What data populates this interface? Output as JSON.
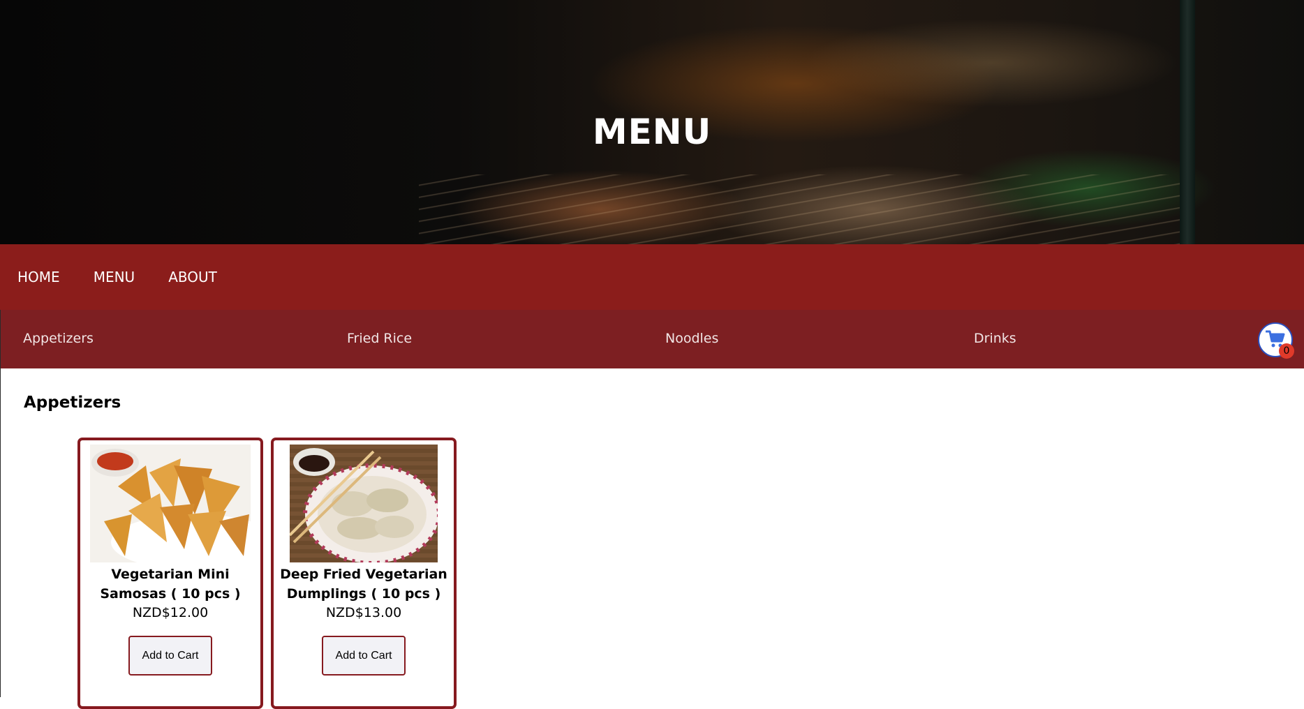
{
  "hero": {
    "title": "MENU"
  },
  "main_nav": {
    "items": [
      {
        "label": "HOME"
      },
      {
        "label": "MENU"
      },
      {
        "label": "ABOUT"
      }
    ]
  },
  "category_nav": {
    "items": [
      {
        "label": "Appetizers"
      },
      {
        "label": "Fried Rice"
      },
      {
        "label": "Noodles"
      },
      {
        "label": "Drinks"
      }
    ],
    "cart": {
      "icon": "shopping-cart-icon",
      "count": "0"
    }
  },
  "section": {
    "title": "Appetizers",
    "products": [
      {
        "name": "Vegetarian Mini Samosas ( 10 pcs )",
        "price": "NZD$12.00",
        "button_label": "Add to Cart",
        "image": "samosas-photo"
      },
      {
        "name": "Deep Fried Vegetarian Dumplings ( 10 pcs )",
        "price": "NZD$13.00",
        "button_label": "Add to Cart",
        "image": "dumplings-photo"
      }
    ]
  },
  "colors": {
    "nav_primary": "#8b1d1b",
    "nav_secondary": "#7d1f22",
    "card_border": "#861a1f",
    "cart_badge": "#e03a2a",
    "cart_icon": "#3b6fe0"
  }
}
